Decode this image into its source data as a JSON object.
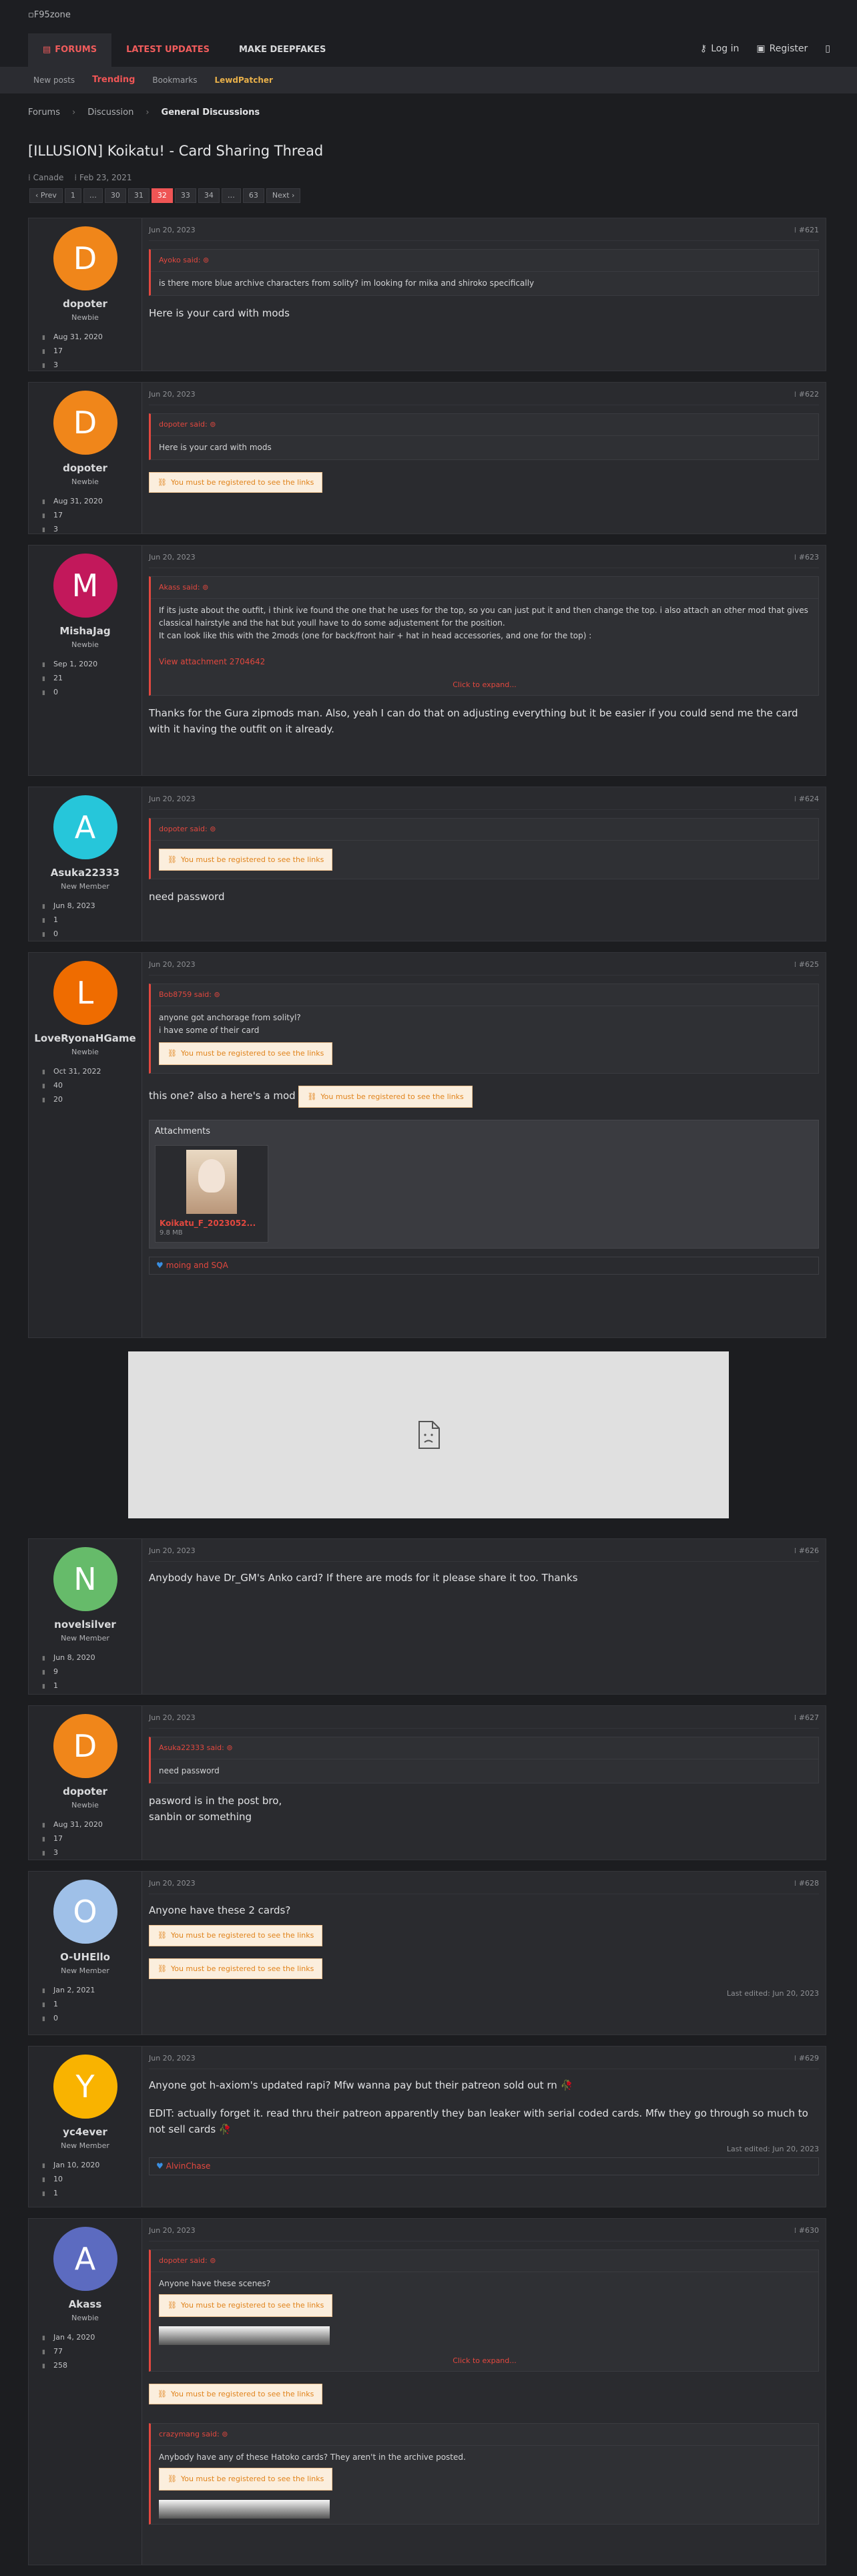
{
  "site": {
    "logo_alt": "F95zone"
  },
  "nav": {
    "tabs": [
      {
        "label": "Forums",
        "icon": "chat-icon"
      },
      {
        "label": "Latest Updates"
      },
      {
        "label": "Make DeepFakes"
      }
    ]
  },
  "user_links": {
    "login": "Log in",
    "register": "Register"
  },
  "subnav": [
    "New posts",
    "Trending",
    "Bookmarks",
    "LewdPatcher"
  ],
  "breadcrumb": [
    "Forums",
    "Discussion",
    "General Discussions"
  ],
  "thread": {
    "title": "[ILLUSION] Koikatu! - Card Sharing Thread",
    "author": "Canade",
    "date": "Feb 23, 2021"
  },
  "pagination": [
    "‹ Prev",
    "1",
    "…",
    "30",
    "31",
    "32",
    "33",
    "34",
    "…",
    "63",
    "Next ›"
  ],
  "reg_notice": "You must be registered to see the links",
  "posts": [
    {
      "user": "dopoter",
      "title": "Newbie",
      "initial": "D",
      "color": "#f0861a",
      "joined": "Aug 31, 2020",
      "messages": "17",
      "reactions": "3",
      "date": "Jun 20, 2023",
      "num": "#621",
      "quote_author": "Ayoko said:",
      "quote_text": "is there more blue archive characters from solity? im looking for mika and shiroko specifically",
      "text": "Here is your card with mods"
    },
    {
      "user": "dopoter",
      "title": "Newbie",
      "initial": "D",
      "color": "#f0861a",
      "joined": "Aug 31, 2020",
      "messages": "17",
      "reactions": "3",
      "date": "Jun 20, 2023",
      "num": "#622",
      "quote_author": "dopoter said:",
      "quote_text": "Here is your card with mods"
    },
    {
      "user": "MishaJag",
      "title": "Newbie",
      "initial": "M",
      "color": "#c2185b",
      "joined": "Sep 1, 2020",
      "messages": "21",
      "reactions": "0",
      "date": "Jun 20, 2023",
      "num": "#623",
      "quote_author": "Akass said:",
      "quote_l1": "If its juste about the outfit, i think ive found the one that he uses for the top, so you can just put it and then change the top. i also attach an other mod that gives classical hairstyle and the hat but youll have to do some adjustement for the position.",
      "quote_l2": "It can look like this with the 2mods (one for back/front hair + hat in head accessories, and one for the top) :",
      "quote_link": "View attachment 2704642",
      "expand": "Click to expand...",
      "text": "Thanks for the Gura zipmods man. Also, yeah I can do that on adjusting everything but it be easier if you could send me the card with it having the outfit on it already."
    },
    {
      "user": "Asuka22333",
      "title": "New Member",
      "initial": "A",
      "color": "#26c6da",
      "joined": "Jun 8, 2023",
      "messages": "1",
      "reactions": "0",
      "date": "Jun 20, 2023",
      "num": "#624",
      "quote_author": "dopoter said:",
      "text": "need password"
    },
    {
      "user": "LoveRyonaHGame",
      "title": "Newbie",
      "initial": "L",
      "color": "#ef6c00",
      "joined": "Oct 31, 2022",
      "messages": "40",
      "reactions": "20",
      "date": "Jun 20, 2023",
      "num": "#625",
      "quote_author": "Bob8759 said:",
      "quote_l1": "anyone got anchorage from solityl?",
      "quote_l2": "i have some of their card",
      "text": "this one? also a here's a mod",
      "attach_title": "Attachments",
      "file_name": "Koikatu_F_2023052...",
      "file_size": "9.8 MB",
      "reaction_users": "moing and SQA"
    },
    {
      "user": "novelsilver",
      "title": "New Member",
      "initial": "N",
      "color": "#66bb6a",
      "joined": "Jun 8, 2020",
      "messages": "9",
      "reactions": "1",
      "date": "Jun 20, 2023",
      "num": "#626",
      "text": "Anybody have Dr_GM's Anko card? If there are mods for it please share it too. Thanks"
    },
    {
      "user": "dopoter",
      "title": "Newbie",
      "initial": "D",
      "color": "#f0861a",
      "joined": "Aug 31, 2020",
      "messages": "17",
      "reactions": "3",
      "date": "Jun 20, 2023",
      "num": "#627",
      "quote_author": "Asuka22333 said:",
      "quote_text": "need password",
      "text1": "pasword is in the post bro,",
      "text2": "sanbin or something"
    },
    {
      "user": "O-UHEllo",
      "title": "New Member",
      "initial": "O",
      "color": "#9fc0e8",
      "joined": "Jan 2, 2021",
      "messages": "1",
      "reactions": "0",
      "date": "Jun 20, 2023",
      "num": "#628",
      "text": "Anyone have these 2 cards?",
      "edited": "Last edited: Jun 20, 2023"
    },
    {
      "user": "yc4ever",
      "title": "New Member",
      "initial": "Y",
      "color": "#f9b300",
      "joined": "Jan 10, 2020",
      "messages": "10",
      "reactions": "1",
      "date": "Jun 20, 2023",
      "num": "#629",
      "text1": "Anyone got h-axiom's updated rapi? Mfw wanna pay but their patreon sold out rn 🥀",
      "text2": "EDIT: actually forget it. read thru their patreon apparently they ban leaker with serial coded cards. Mfw they go through so much to not sell cards 🥀",
      "edited": "Last edited: Jun 20, 2023",
      "reaction_users": "AlvinChase"
    },
    {
      "user": "Akass",
      "title": "Newbie",
      "initial": "A",
      "color": "#5c6bc0",
      "joined": "Jan 4, 2020",
      "messages": "77",
      "reactions": "258",
      "date": "Jun 20, 2023",
      "num": "#630",
      "quote_author": "dopoter said:",
      "quote_text": "Anyone have these scenes?",
      "expand": "Click to expand...",
      "quote2_author": "crazymang said:",
      "quote2_text": "Anybody have any of these Hatoko cards? They aren't in the archive posted."
    }
  ]
}
